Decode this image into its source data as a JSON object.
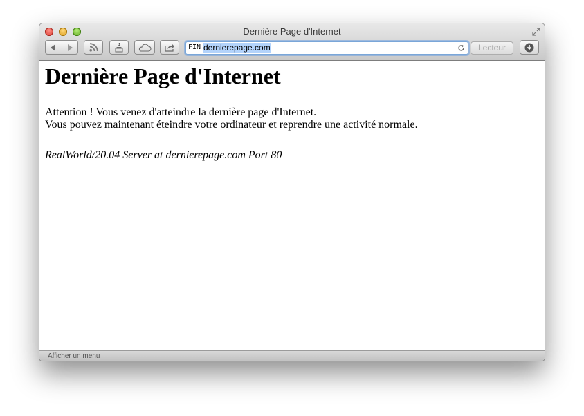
{
  "window": {
    "title": "Dernière Page d'Internet"
  },
  "toolbar": {
    "reading_list_count": "4",
    "address": {
      "prefix": "FIN",
      "url": "dernierepage.com"
    },
    "reader_label": "Lecteur"
  },
  "page": {
    "heading": "Dernière Page d'Internet",
    "line1": "Attention ! Vous venez d'atteindre la dernière page d'Internet.",
    "line2": "Vous pouvez maintenant éteindre votre ordinateur et reprendre une activité normale.",
    "signature": "RealWorld/20.04 Server at dernierepage.com Port 80"
  },
  "status": {
    "text": "Afficher un menu"
  },
  "icons": {
    "back": "back-arrow-icon",
    "forward": "forward-arrow-icon",
    "rss": "rss-icon",
    "reading_list": "reading-list-icon",
    "icloud": "icloud-icon",
    "share": "share-icon",
    "reload": "reload-icon",
    "download": "download-icon",
    "fullscreen": "fullscreen-icon"
  },
  "colors": {
    "address_focus": "#7aa6d8",
    "url_selection": "#b3d3fb"
  }
}
